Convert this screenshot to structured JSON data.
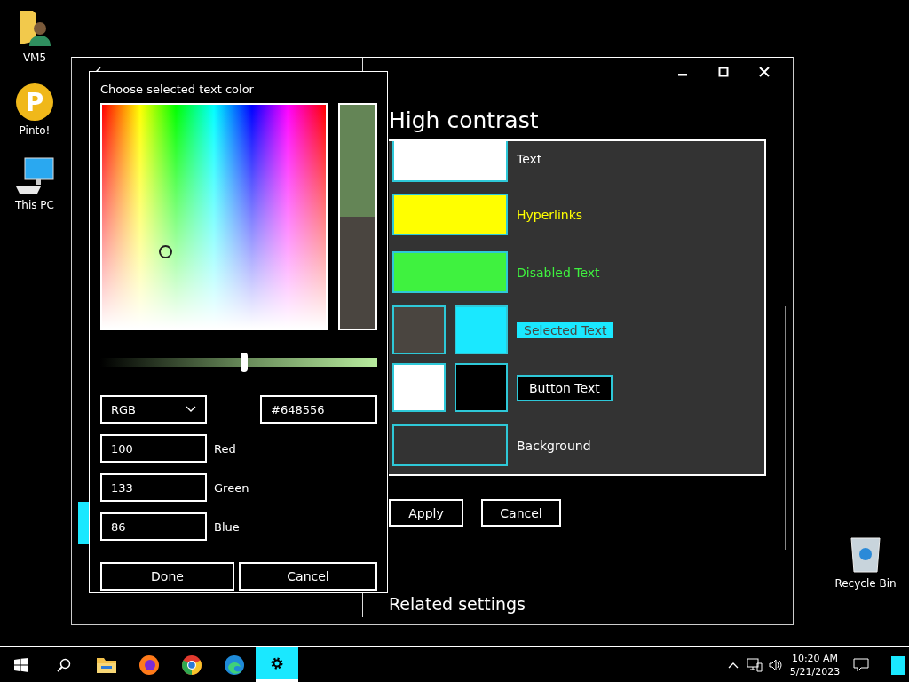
{
  "desktop_icons": [
    {
      "kind": "user-folder",
      "label": "VM5"
    },
    {
      "kind": "app",
      "label": "Pinto!",
      "logo_text": "P"
    },
    {
      "kind": "computer",
      "label": "This PC"
    },
    {
      "kind": "recycle-bin",
      "label": "Recycle Bin"
    }
  ],
  "settings_window": {
    "heading": "High contrast",
    "rows": [
      {
        "kind": "plain",
        "label": "Text",
        "swatches": [
          {
            "color": "#ffffff"
          }
        ]
      },
      {
        "kind": "plain",
        "label": "Hyperlinks",
        "swatches": [
          {
            "color": "#ffff00"
          }
        ]
      },
      {
        "kind": "plain",
        "label": "Disabled Text",
        "swatches": [
          {
            "color": "#3ff23f"
          }
        ]
      },
      {
        "kind": "highlight",
        "label": "Selected Text",
        "swatches": [
          {
            "color": "#4a4540"
          },
          {
            "color": "#1ae8ff"
          }
        ]
      },
      {
        "kind": "button",
        "label": "Button Text",
        "swatches": [
          {
            "color": "#ffffff"
          },
          {
            "color": "#000000"
          }
        ]
      },
      {
        "kind": "plain-muted",
        "label": "Background",
        "swatches": [
          {
            "color": "#333333"
          }
        ]
      }
    ],
    "buttons": [
      "Apply",
      "Cancel"
    ],
    "related_heading": "Related settings"
  },
  "color_dialog": {
    "title": "Choose selected text color",
    "preview_swatches": [
      {
        "color": "#648556"
      },
      {
        "color": "#4a4540"
      }
    ],
    "brightness": {
      "level": 0.52
    },
    "mode": "RGB",
    "hex": "#648556",
    "channels": [
      {
        "value": "100",
        "label": "Red"
      },
      {
        "value": "133",
        "label": "Green"
      },
      {
        "value": "86",
        "label": "Blue"
      }
    ],
    "buttons": [
      "Done",
      "Cancel"
    ]
  },
  "taskbar": {
    "apps": [
      {
        "kind": "folder",
        "selected": false
      },
      {
        "kind": "firefox",
        "selected": false
      },
      {
        "kind": "chrome",
        "selected": false
      },
      {
        "kind": "edge",
        "selected": false
      },
      {
        "kind": "settings",
        "selected": true
      }
    ],
    "time": "10:20 AM",
    "date": "5/21/2023"
  }
}
